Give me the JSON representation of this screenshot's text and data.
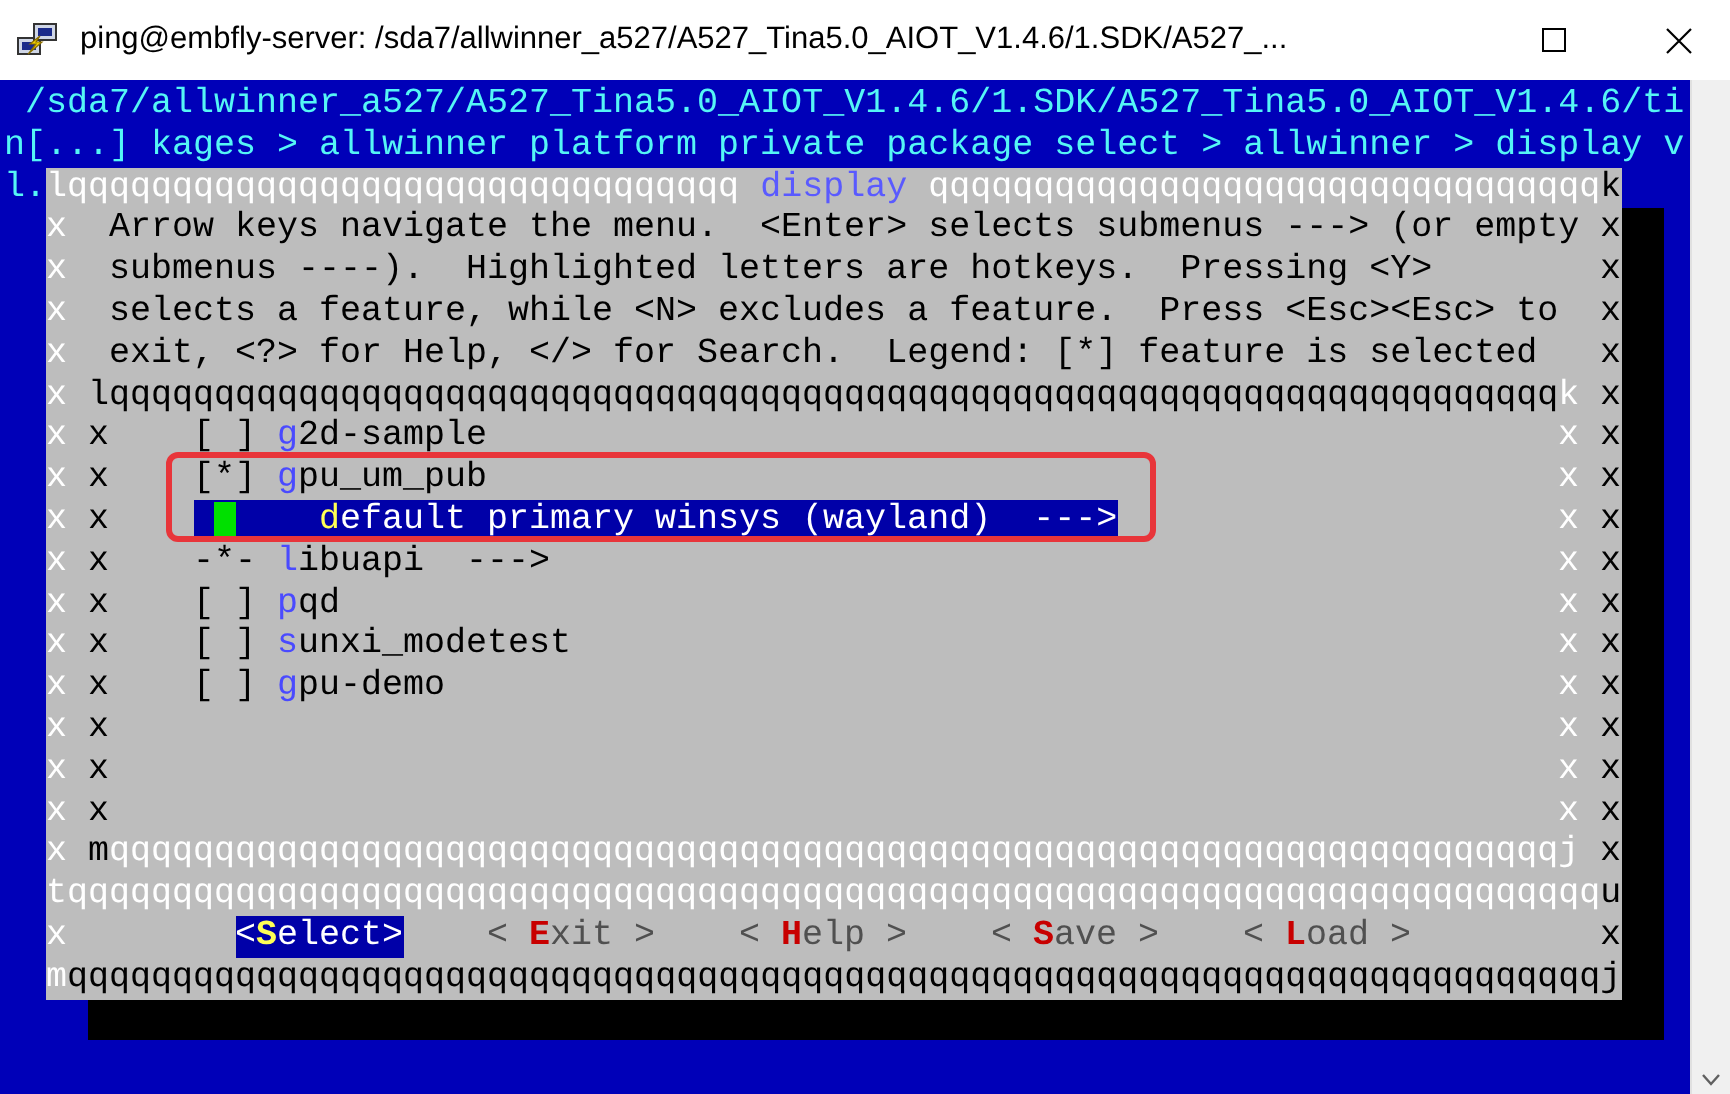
{
  "window": {
    "title": "ping@embfly-server: /sda7/allwinner_a527/A527_Tina5.0_AIOT_V1.4.6/1.SDK/A527_..."
  },
  "terminal": {
    "path_line": "/sda7/allwinner_a527/A527_Tina5.0_AIOT_V1.4.6/1.SDK/A527_Tina5.0_AIOT_V1.4.6/ti",
    "breadcrumb_line": "n[...] kages > allwinner platform private package select > allwinner > display v",
    "leftover": "l."
  },
  "dialog": {
    "top_border": [
      {
        "text": "lqqqqqqqqqqqqqqqqqqqqqqqqqqqqqqqq",
        "kind": "light"
      },
      {
        "text": "display",
        "kind": "title"
      },
      {
        "text": "qqqqqqqqqqqqqqqqqqqqqqqqqqqqqqqq",
        "kind": "light"
      },
      {
        "text": "k",
        "kind": "shadow"
      }
    ],
    "help": [
      "Arrow keys navigate the menu.  <Enter> selects submenus ---> (or empty",
      "submenus ----).  Highlighted letters are hotkeys.  Pressing <Y>",
      "selects a feature, while <N> excludes a feature.  Press <Esc><Esc> to",
      "exit, <?> for Help, </> for Search.  Legend: [*] feature is selected"
    ],
    "list_top": [
      {
        "text": "lqqqqqqqqqqqqqqqqqqqqqqqqqqqqqqqqqqqqqqqqqqqqqqqqqqqqqqqqqqqqqqqqqqqqq",
        "kind": "shadow"
      },
      {
        "text": "k",
        "kind": "light"
      }
    ],
    "items": [
      {
        "marker": "[ ]",
        "label": "g2d-sample",
        "selected": false
      },
      {
        "marker": "[*]",
        "label": "gpu_um_pub",
        "selected": false,
        "children": [
          {
            "label": "default primary winsys (wayland)",
            "submenu": "--->",
            "selected": true
          }
        ]
      },
      {
        "marker": "-*-",
        "label": "libuapi",
        "submenu": "--->",
        "selected": false
      },
      {
        "marker": "[ ]",
        "label": "pqd",
        "selected": false
      },
      {
        "marker": "[ ]",
        "label": "sunxi_modetest",
        "selected": false
      },
      {
        "marker": "[ ]",
        "label": "gpu-demo",
        "selected": false
      }
    ],
    "list_bottom": [
      {
        "text": "m",
        "kind": "shadow"
      },
      {
        "text": "qqqqqqqqqqqqqqqqqqqqqqqqqqqqqqqqqqqqqqqqqqqqqqqqqqqqqqqqqqqqqqqqqqqqqj",
        "kind": "light"
      }
    ],
    "separator": [
      {
        "text": "tqqqqqqqqqqqqqqqqqqqqqqqqqqqqqqqqqqqqqqqqqqqqqqqqqqqqqqqqqqqqqqqqqqqqqqqqq",
        "kind": "light"
      },
      {
        "text": "u",
        "kind": "shadow"
      }
    ],
    "buttons": [
      {
        "label": "<Select>",
        "selected": true
      },
      {
        "label": "< Exit >",
        "selected": false
      },
      {
        "label": "< Help >",
        "selected": false
      },
      {
        "label": "< Save >",
        "selected": false
      },
      {
        "label": "< Load >",
        "selected": false
      }
    ],
    "bottom_border": [
      {
        "text": "m",
        "kind": "light"
      },
      {
        "text": "qqqqqqqqqqqqqqqqqqqqqqqqqqqqqqqqqqqqqqqqqqqqqqqqqqqqqqqqqqqqqqqqqqqqqqqqqj",
        "kind": "shadow"
      }
    ],
    "edges": {
      "outer_left": "xxxxxxxxxxxxxxxx",
      "outer_right": "xxxxxxxxxxxxxxxx",
      "inner_left": "xxxxxxxxxx",
      "inner_right": "xxxxxxxxxx",
      "button_left": "x",
      "button_right": "x"
    }
  }
}
